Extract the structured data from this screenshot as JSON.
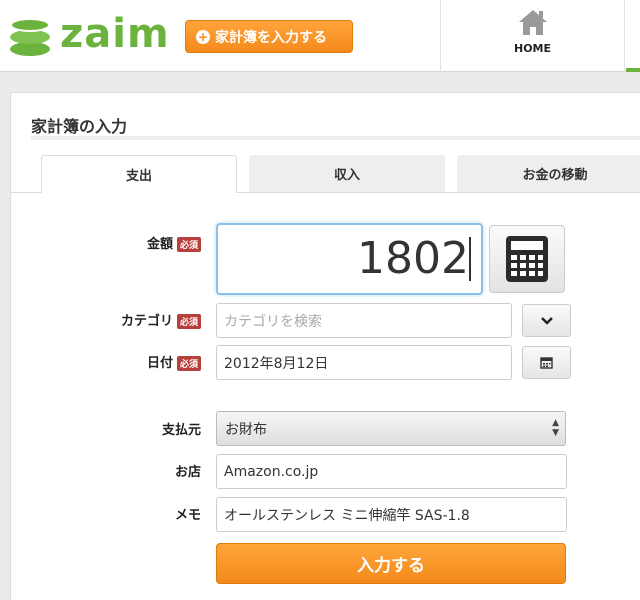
{
  "header": {
    "logo_text": "zaim",
    "add_button_label": "家計簿を入力する",
    "nav_home_label": "HOME"
  },
  "panel": {
    "title": "家計簿の入力",
    "tabs": [
      {
        "label": "支出",
        "active": true
      },
      {
        "label": "収入",
        "active": false
      },
      {
        "label": "お金の移動",
        "active": false
      }
    ]
  },
  "form": {
    "required_badge": "必須",
    "amount": {
      "label": "金額",
      "value": "1802"
    },
    "category": {
      "label": "カテゴリ",
      "placeholder": "カテゴリを検索",
      "value": ""
    },
    "date": {
      "label": "日付",
      "value": "2012年8月12日"
    },
    "payment": {
      "label": "支払元",
      "value": "お財布"
    },
    "shop": {
      "label": "お店",
      "value": "Amazon.co.jp"
    },
    "memo": {
      "label": "メモ",
      "value": "オールステンレス ミニ伸縮竿 SAS-1.8"
    },
    "submit_label": "入力する"
  },
  "colors": {
    "brand_green": "#6cb33e",
    "accent_orange": "#f48a1c",
    "required_red": "#b5403c",
    "focus_blue": "#8cc0e8"
  }
}
